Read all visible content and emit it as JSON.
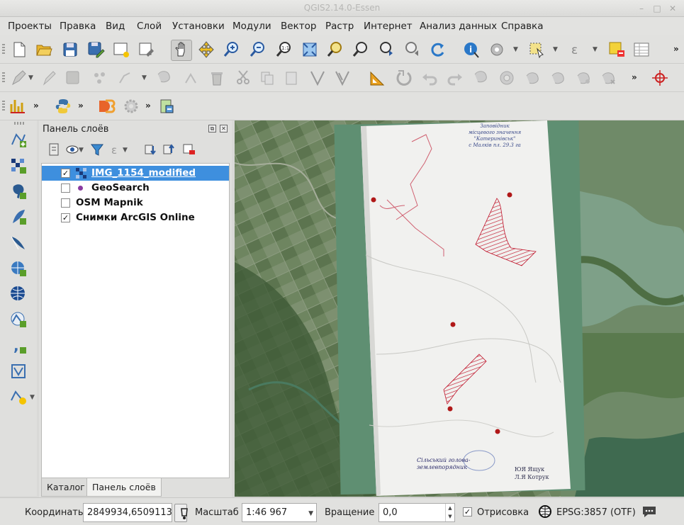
{
  "window": {
    "title": "QGIS2.14.0-Essen",
    "controls": [
      "minimize-icon",
      "maximize-icon",
      "close-icon"
    ]
  },
  "menu": [
    "Проекты",
    "Правка",
    "Вид",
    "Слой",
    "Установки",
    "Модули",
    "Вектор",
    "Растр",
    "Интернет",
    "Анализ данных",
    "Справка"
  ],
  "toolbar_more": "»",
  "layer_panel": {
    "title": "Панель слоёв",
    "layers": [
      {
        "name": "IMG_1154_modified",
        "checked": true,
        "selected": true,
        "icon": "raster-icon"
      },
      {
        "name": "GeoSearch",
        "checked": false,
        "selected": false,
        "icon": "point-layer-icon"
      },
      {
        "name": "OSM Mapnik",
        "checked": false,
        "selected": false,
        "icon": ""
      },
      {
        "name": "Снимки ArcGIS Online",
        "checked": true,
        "selected": false,
        "icon": ""
      }
    ],
    "tabs": [
      "Каталог",
      "Панель слоёв"
    ],
    "active_tab": "Панель слоёв"
  },
  "map_annotations": {
    "title_lines": [
      "Заповідник",
      "місцевого значення",
      "\"Катеринівськ\"",
      "с Малків пл. 29.3 га"
    ],
    "footer_left": [
      "Сільський голова-",
      "землевпорядник"
    ],
    "footer_right": [
      "ЮЯ Ящук",
      "Л.Я Котрук"
    ]
  },
  "status": {
    "coord_label": "Координаты",
    "coord_value": "2849934,6509113",
    "scale_label": "Масштаб",
    "scale_value": "1:46 967",
    "rotation_label": "Вращение",
    "rotation_value": "0,0",
    "render_label": "Отрисовка",
    "render_checked": true,
    "crs": "EPSG:3857 (OTF)"
  },
  "colors": {
    "selection": "#3e8fde",
    "panel_bg": "#dfdfdd",
    "hatch_red": "#c0142a"
  }
}
